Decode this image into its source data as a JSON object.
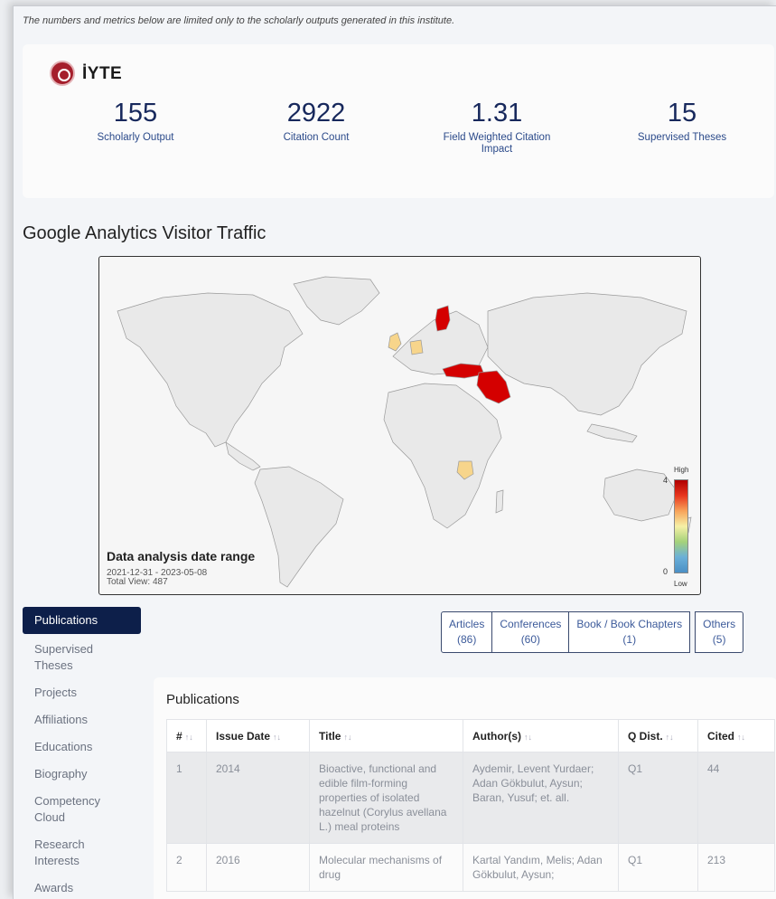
{
  "notice": "The numbers and metrics below are limited only to the scholarly outputs generated in this institute.",
  "institution": {
    "name": "İYTE",
    "logo_icon": "institution-seal-icon"
  },
  "metrics": [
    {
      "value": "155",
      "label": "Scholarly Output"
    },
    {
      "value": "2922",
      "label": "Citation Count"
    },
    {
      "value": "1.31",
      "label": "Field Weighted Citation Impact"
    },
    {
      "value": "15",
      "label": "Supervised Theses"
    }
  ],
  "analytics": {
    "title": "Google Analytics Visitor Traffic",
    "range_title": "Data analysis date range",
    "range_dates": "2021-12-31 - 2023-05-08",
    "total_view": "Total View: 487",
    "legend": {
      "high": "High",
      "low": "Low",
      "max": "4",
      "min": "0"
    },
    "colors": {
      "high": "#d40000",
      "mid": "#f7d58b",
      "base": "#e9e9e9"
    }
  },
  "nav": {
    "items": [
      "Publications",
      "Supervised Theses",
      "Projects",
      "Affiliations",
      "Educations",
      "Biography",
      "Competency Cloud",
      "Research Interests",
      "Awards"
    ],
    "active": "Publications"
  },
  "filters": [
    {
      "label": "Articles",
      "count": "(86)"
    },
    {
      "label": "Conferences",
      "count": "(60)"
    },
    {
      "label": "Book / Book Chapters",
      "count": "(1)"
    },
    {
      "label": "Others",
      "count": "(5)"
    }
  ],
  "publications": {
    "title": "Publications",
    "columns": [
      "#",
      "Issue Date",
      "Title",
      "Author(s)",
      "Q Dist.",
      "Cited"
    ],
    "rows": [
      {
        "n": "1",
        "date": "2014",
        "title": "Bioactive, functional and edible film-forming properties of isolated hazelnut (Corylus avellana L.) meal proteins",
        "authors": "Aydemir, Levent Yurdaer; Adan Gökbulut, Aysun; Baran, Yusuf; et. all.",
        "q": "Q1",
        "cited": "44"
      },
      {
        "n": "2",
        "date": "2016",
        "title": "Molecular mechanisms of drug",
        "authors": "Kartal Yandım, Melis; Adan Gökbulut, Aysun;",
        "q": "Q1",
        "cited": "213"
      }
    ]
  }
}
